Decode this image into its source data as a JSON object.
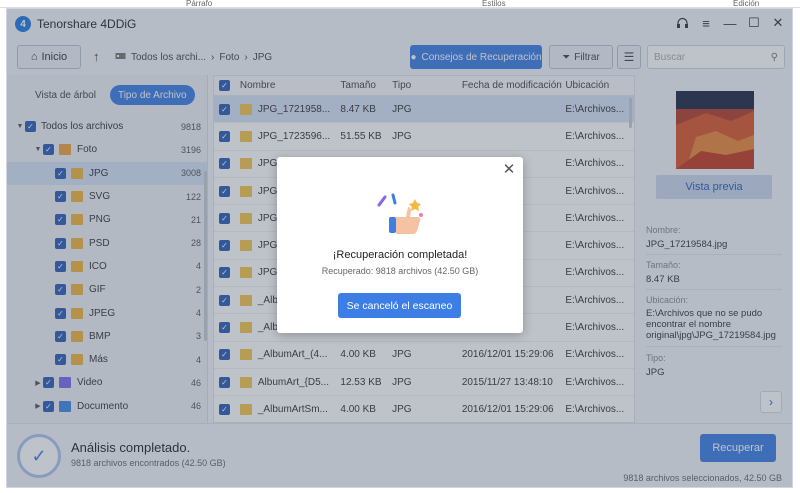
{
  "background_doc": {
    "parrafo": "Párrafo",
    "estilos": "Estilos",
    "edicion": "Edición"
  },
  "app": {
    "title": "Tenorshare 4DDiG",
    "logo_letter": "4"
  },
  "toolbar": {
    "home_label": "Inicio",
    "breadcrumb": [
      "Todos los archi...",
      "Foto",
      "JPG"
    ],
    "tips_label": "Consejos de Recuperación",
    "filter_label": "Filtrar",
    "search_placeholder": "Buscar"
  },
  "sidebar": {
    "tabs": [
      "Vista de árbol",
      "Tipo de Archivo"
    ],
    "active_tab": "Tipo de Archivo",
    "tree": [
      {
        "label": "Todos los archivos",
        "count": "9818",
        "level": 0
      },
      {
        "label": "Foto",
        "count": "3196",
        "level": 1
      },
      {
        "label": "JPG",
        "count": "3008",
        "level": 2
      },
      {
        "label": "SVG",
        "count": "122",
        "level": 2
      },
      {
        "label": "PNG",
        "count": "21",
        "level": 2
      },
      {
        "label": "PSD",
        "count": "28",
        "level": 2
      },
      {
        "label": "ICO",
        "count": "4",
        "level": 2
      },
      {
        "label": "GIF",
        "count": "2",
        "level": 2
      },
      {
        "label": "JPEG",
        "count": "4",
        "level": 2
      },
      {
        "label": "BMP",
        "count": "3",
        "level": 2
      },
      {
        "label": "Más",
        "count": "4",
        "level": 2
      },
      {
        "label": "Video",
        "count": "46",
        "level": 1
      },
      {
        "label": "Documento",
        "count": "46",
        "level": 1
      }
    ]
  },
  "filelist": {
    "columns": [
      "Nombre",
      "Tamaño",
      "Tipo",
      "Fecha de modificación",
      "Ubicación"
    ],
    "rows": [
      {
        "name": "JPG_1721958...",
        "size": "8.47 KB",
        "type": "JPG",
        "date": "",
        "loc": "E:\\Archivos..."
      },
      {
        "name": "JPG_1723596...",
        "size": "51.55 KB",
        "type": "JPG",
        "date": "",
        "loc": "E:\\Archivos..."
      },
      {
        "name": "JPG_",
        "size": "",
        "type": "",
        "date": "",
        "loc": "E:\\Archivos..."
      },
      {
        "name": "JPG_",
        "size": "",
        "type": "",
        "date": "",
        "loc": "E:\\Archivos..."
      },
      {
        "name": "JPG_",
        "size": "",
        "type": "",
        "date": "",
        "loc": "E:\\Archivos..."
      },
      {
        "name": "JPG_",
        "size": "",
        "type": "",
        "date": "",
        "loc": "E:\\Archivos..."
      },
      {
        "name": "JPG_",
        "size": "",
        "type": "",
        "date": "",
        "loc": "E:\\Archivos..."
      },
      {
        "name": "_Album",
        "size": "",
        "type": "",
        "date": "5:29:06",
        "loc": "E:\\Archivos..."
      },
      {
        "name": "_Album",
        "size": "",
        "type": "",
        "date": "5:29:06",
        "loc": "E:\\Archivos..."
      },
      {
        "name": "_AlbumArt_(4...",
        "size": "4.00 KB",
        "type": "JPG",
        "date": "2016/12/01 15:29:06",
        "loc": "E:\\Archivos..."
      },
      {
        "name": "AlbumArt_{D5...",
        "size": "12.53 KB",
        "type": "JPG",
        "date": "2015/11/27 13:48:10",
        "loc": "E:\\Archivos..."
      },
      {
        "name": "_AlbumArtSm...",
        "size": "4.00 KB",
        "type": "JPG",
        "date": "2016/12/01 15:29:06",
        "loc": "E:\\Archivos..."
      }
    ]
  },
  "preview": {
    "button": "Vista previa",
    "name_label": "Nombre:",
    "name_value": "JPG_17219584.jpg",
    "size_label": "Tamaño:",
    "size_value": "8.47 KB",
    "loc_label": "Ubicación:",
    "loc_value": "E:\\Archivos que no se pudo encontrar el nombre original\\jpg\\JPG_17219584.jpg",
    "type_label": "Tipo:",
    "type_value": "JPG"
  },
  "bottom": {
    "title": "Análisis completado.",
    "subtitle": "9818 archivos encontrados (42.50 GB)",
    "recover_label": "Recuperar",
    "selected_info": "9818 archivos seleccionados, 42.50 GB"
  },
  "modal": {
    "title": "¡Recuperación completada!",
    "subtitle": "Recuperado: 9818 archivos (42.50 GB)",
    "button": "Se canceló el escaneo"
  },
  "colors": {
    "accent": "#3d7ee6",
    "checkbox": "#2b5fb8",
    "selected_row": "#d6e2f5"
  }
}
